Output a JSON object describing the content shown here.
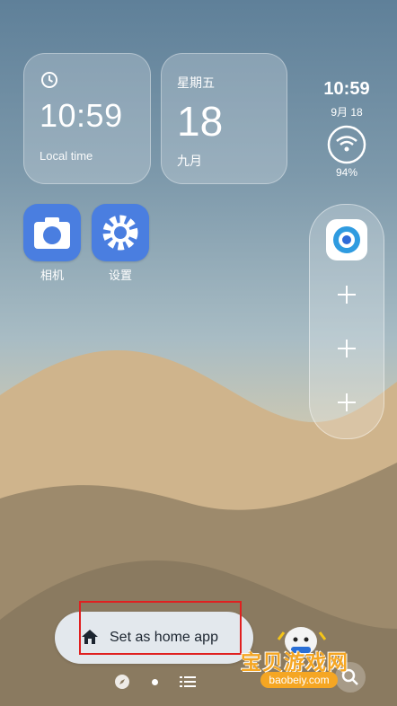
{
  "widgets": {
    "clock": {
      "time": "10:59",
      "label": "Local time"
    },
    "date": {
      "weekday": "星期五",
      "day": "18",
      "month": "九月"
    }
  },
  "status": {
    "time": "10:59",
    "date": "9月 18",
    "battery": "94%"
  },
  "apps": [
    {
      "label": "相机",
      "icon": "camera-icon"
    },
    {
      "label": "设置",
      "icon": "gear-icon"
    }
  ],
  "dock": {
    "app_icon": "browser-app-icon",
    "add_slots": 3
  },
  "home_prompt": {
    "label": "Set as home app",
    "icon": "home-icon"
  },
  "watermark": {
    "text": "宝贝游戏网",
    "url": "baobeiy.com"
  },
  "colors": {
    "accent": "#4a7ee0",
    "highlight": "#e02020",
    "watermark": "#f5a623"
  }
}
